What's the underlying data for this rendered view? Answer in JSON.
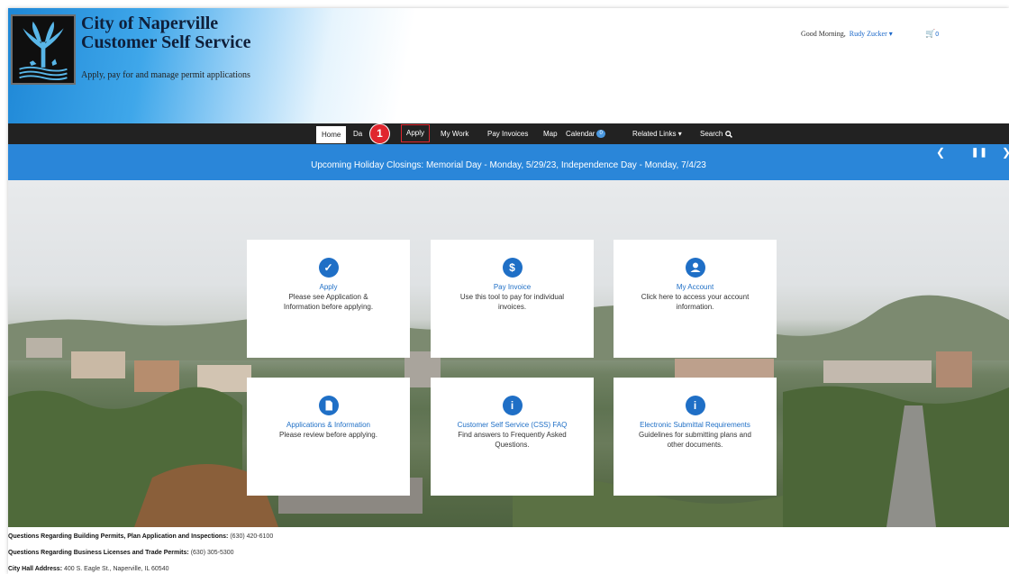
{
  "header": {
    "title_line1": "City of Naperville",
    "title_line2": "Customer Self Service",
    "tagline": "Apply, pay for and manage permit applications",
    "greeting": "Good Morning,",
    "user_name": "Rudy Zucker ▾",
    "cart_count": "0"
  },
  "nav": {
    "home": "Home",
    "dashboard": "Da",
    "dashboard_tail": "d",
    "apply": "Apply",
    "my_work": "My Work",
    "pay_invoices": "Pay Invoices",
    "map": "Map",
    "calendar": "Calendar",
    "calendar_badge": "0",
    "related_links": "Related Links ▾",
    "search": "Search"
  },
  "step_marker": "1",
  "announcement": {
    "text": "Upcoming Holiday Closings: Memorial Day - Monday, 5/29/23, Independence Day - Monday, 7/4/23"
  },
  "cards": [
    {
      "icon": "apply-icon",
      "title": "Apply",
      "desc": "Please see Application & Information before applying."
    },
    {
      "icon": "dollar-icon",
      "title": "Pay Invoice",
      "desc": "Use this tool to pay for individual invoices."
    },
    {
      "icon": "user-icon",
      "title": "My Account",
      "desc": "Click here to access your account information."
    },
    {
      "icon": "document-icon",
      "title": "Applications & Information",
      "desc": "Please review before applying."
    },
    {
      "icon": "info-icon",
      "title": "Customer Self Service (CSS) FAQ",
      "desc": "Find answers to Frequently Asked Questions."
    },
    {
      "icon": "info-icon",
      "title": "Electronic Submittal Requirements",
      "desc": "Guidelines for submitting plans and other documents."
    }
  ],
  "footer": {
    "line1_label": "Questions Regarding Building Permits, Plan Application and Inspections:",
    "line1_value": "(630) 420-6100",
    "line2_label": "Questions Regarding Business Licenses and Trade Permits:",
    "line2_value": "(630) 305-5300",
    "line3_label": "City Hall Address:",
    "line3_value": "400 S. Eagle St., Naperville, IL 60540"
  },
  "colors": {
    "accent_blue": "#1f6fc6",
    "nav_bg": "#222222",
    "announcement_bg": "#2a86d9",
    "highlight_red": "#e0262e"
  }
}
